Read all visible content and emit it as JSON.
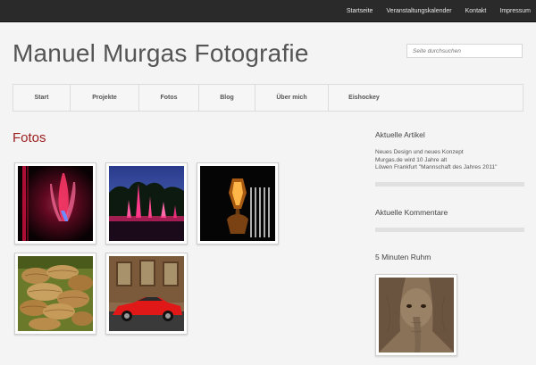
{
  "top_nav": [
    "Startseite",
    "Veranstaltungskalender",
    "Kontakt",
    "Impressum"
  ],
  "site_title": "Manuel Murgas Fotografie",
  "search": {
    "placeholder": "Seite durchsuchen"
  },
  "main_nav": [
    {
      "label": "Start"
    },
    {
      "label": "Projekte"
    },
    {
      "label": "Fotos"
    },
    {
      "label": "Blog"
    },
    {
      "label": "Über mich"
    },
    {
      "label": "Eishockey"
    }
  ],
  "page_heading": "Fotos",
  "gallery": [
    {
      "icon": "red-light-photo-icon"
    },
    {
      "icon": "fountain-photo-icon"
    },
    {
      "icon": "lantern-photo-icon"
    },
    {
      "icon": "mushroom-photo-icon"
    },
    {
      "icon": "red-car-photo-icon"
    }
  ],
  "sidebar": {
    "articles_title": "Aktuelle Artikel",
    "articles": [
      "Neues Design und neues Konzept",
      "Murgas.de wird 10 Jahre alt",
      "Löwen Frankfurt \"Mannschaft des Jahres 2011\""
    ],
    "comments_title": "Aktuelle Kommentare",
    "ruhm_title": "5 Minuten Ruhm",
    "ruhm_image_icon": "elephant-photo-icon"
  },
  "colors": {
    "accent": "#9b1e1e",
    "topbar": "#2a2a2a",
    "background": "#f4f4f4"
  }
}
